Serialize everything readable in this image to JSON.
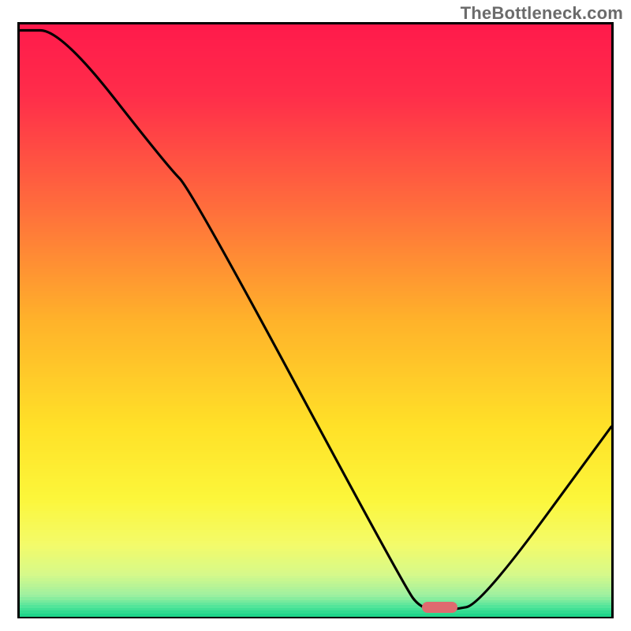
{
  "watermark": "TheBottleneck.com",
  "chart_data": {
    "type": "line",
    "title": "",
    "xlabel": "",
    "ylabel": "",
    "xlim": [
      0,
      100
    ],
    "ylim": [
      0,
      100
    ],
    "x": [
      0,
      7,
      25,
      29,
      65,
      68,
      73,
      78,
      100
    ],
    "values": [
      99,
      99,
      76,
      72,
      5,
      1,
      1,
      2,
      32
    ],
    "marker": {
      "x": 71,
      "width_pct": 6
    },
    "gradient_stops": [
      {
        "pos": 0.0,
        "color": "#ff1a4b"
      },
      {
        "pos": 0.12,
        "color": "#ff2d4a"
      },
      {
        "pos": 0.3,
        "color": "#ff6a3d"
      },
      {
        "pos": 0.5,
        "color": "#ffb22a"
      },
      {
        "pos": 0.68,
        "color": "#ffe128"
      },
      {
        "pos": 0.8,
        "color": "#fcf63a"
      },
      {
        "pos": 0.88,
        "color": "#f3fb6a"
      },
      {
        "pos": 0.93,
        "color": "#d6f98a"
      },
      {
        "pos": 0.965,
        "color": "#9ef0a0"
      },
      {
        "pos": 0.985,
        "color": "#4fe49a"
      },
      {
        "pos": 1.0,
        "color": "#17d487"
      }
    ]
  }
}
